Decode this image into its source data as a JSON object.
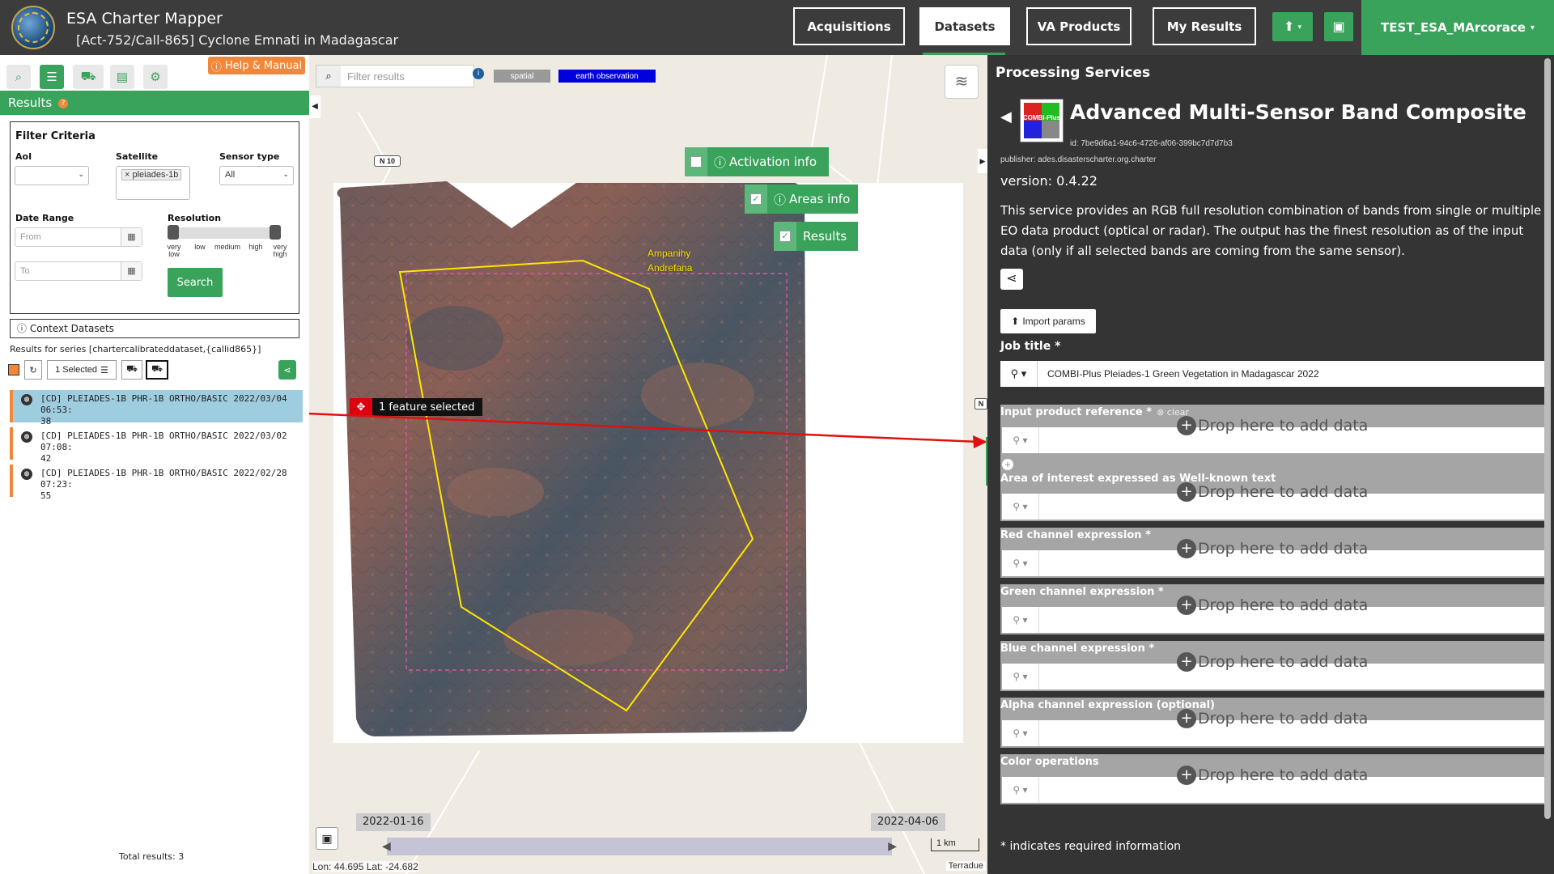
{
  "header": {
    "app_title": "ESA Charter Mapper",
    "activation": "[Act-752/Call-865] Cyclone Emnati in Madagascar",
    "nav": [
      "Acquisitions",
      "Datasets",
      "VA Products",
      "My Results"
    ],
    "active_nav": "Datasets",
    "user": "TEST_ESA_MArcorace",
    "user_caret": "▾",
    "upload_icon": "upload-icon",
    "briefcase_icon": "briefcase-icon",
    "colors": {
      "topbar": "#3c3c3c",
      "accent": "#3aa35b",
      "help": "#f0873a"
    }
  },
  "left": {
    "help_label": "Help & Manual",
    "results_title": "Results",
    "filter": {
      "title": "Filter Criteria",
      "aoi_label": "AoI",
      "satellite_label": "Satellite",
      "satellite_value": "pleiades-1b",
      "sensor_label": "Sensor type",
      "sensor_value": "All",
      "date_label": "Date Range",
      "from_placeholder": "From",
      "to_placeholder": "To",
      "resolution_label": "Resolution",
      "resolution_ticks": [
        "very low",
        "low",
        "medium",
        "high",
        "very high"
      ],
      "search_label": "Search"
    },
    "context_datasets": "Context Datasets",
    "series": "Results for series [chartercalibrateddataset,{callid865}]",
    "selected_label": "1 Selected",
    "results": [
      {
        "line1": "[CD] PLEIADES-1B PHR-1B ORTHO/BASIC 2022/03/04 06:53:",
        "line2": "38",
        "selected": true
      },
      {
        "line1": "[CD] PLEIADES-1B PHR-1B ORTHO/BASIC 2022/03/02 07:08:",
        "line2": "42",
        "selected": false
      },
      {
        "line1": "[CD] PLEIADES-1B PHR-1B ORTHO/BASIC 2022/02/28 07:23:",
        "line2": "55",
        "selected": false
      }
    ],
    "total": "Total results: 3"
  },
  "map": {
    "filter_placeholder": "Filter results",
    "tag_spatial": "spatial",
    "tag_eo": "earth observation",
    "activation_info": "Activation info",
    "areas_info": "Areas info",
    "results": "Results",
    "feature_selected": "1 feature selected",
    "place_line1": "Ampanihy",
    "place_line2": "Andrefana",
    "road_label": "N 10",
    "edge_label": "N",
    "time_start": "2022-01-16",
    "time_end": "2022-04-06",
    "scale": "1 km",
    "coords": "Lon: 44.695 Lat: -24.682",
    "attribution": "Terradue"
  },
  "service": {
    "panel_title": "Processing Services",
    "icon_text": "COMBI-Plus",
    "name": "Advanced Multi-Sensor Band Composite",
    "id": "id: 7be9d6a1-94c6-4726-af06-399bc7d7d7b3",
    "publisher": "publisher: ades.disasterscharter.org.charter",
    "version": "version: 0.4.22",
    "description": "This service provides an RGB full resolution combination of bands from single or multiple EO data product (optical or radar). The output has the finest resolution as of the input data (only if all selected bands are coming from the same sensor).",
    "import_label": "Import params",
    "job_title_label": "Job title *",
    "job_title_value": "COMBI-Plus Pleiades-1 Green Vegetation in Madagascar 2022",
    "clear_label": "clear",
    "drop_label": "Drop here to add data",
    "params": [
      "Input product reference *",
      "Area of interest expressed as Well-known text",
      "Red channel expression *",
      "Green channel expression *",
      "Blue channel expression *",
      "Alpha channel expression (optional)",
      "Color operations"
    ],
    "required_note": "* indicates required information"
  }
}
